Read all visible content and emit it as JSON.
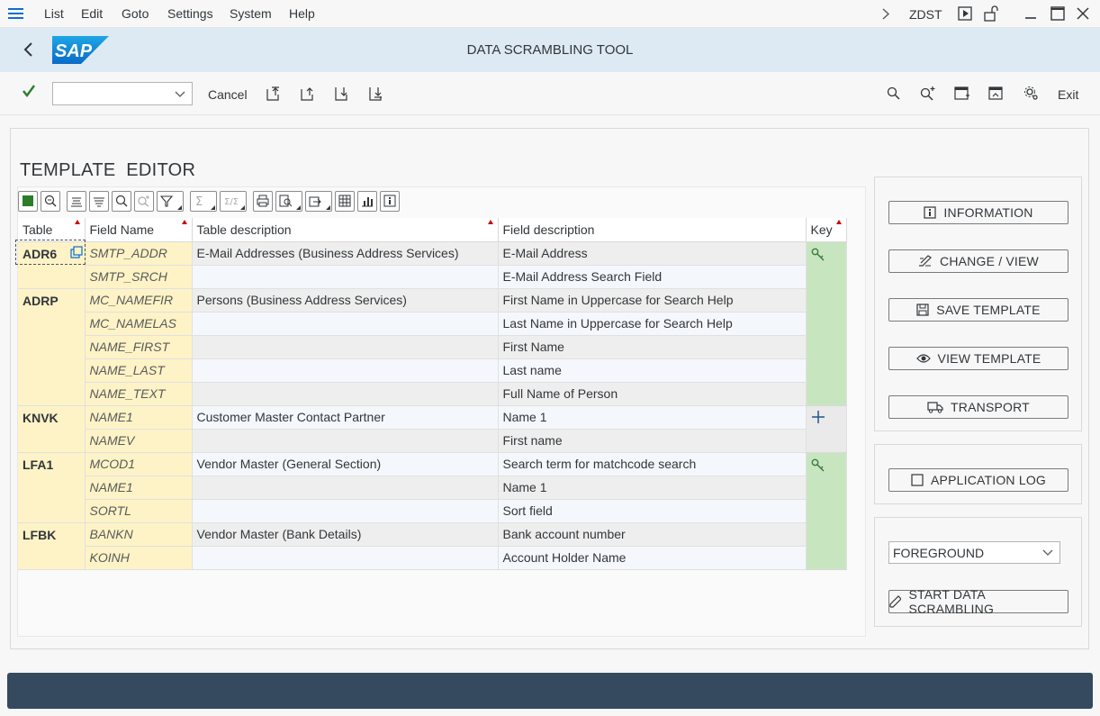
{
  "menu": {
    "items": [
      "List",
      "Edit",
      "Goto",
      "Settings",
      "System",
      "Help"
    ],
    "transaction_code": "ZDST"
  },
  "title_bar": {
    "logo_text": "SAP",
    "title": "DATA SCRAMBLING TOOL"
  },
  "toolbar": {
    "okcode_value": "",
    "cancel_label": "Cancel",
    "exit_label": "Exit"
  },
  "editor": {
    "title": "TEMPLATE  EDITOR",
    "columns": [
      "Table",
      "Field Name",
      "Table description",
      "Field description",
      "Key"
    ],
    "rows": [
      {
        "table": "ADR6",
        "field": "SMTP_ADDR",
        "table_desc": "E-Mail Addresses (Business Address Services)",
        "field_desc": "E-Mail Address",
        "key_icon": "key-icon"
      },
      {
        "table": "",
        "field": "SMTP_SRCH",
        "table_desc": "",
        "field_desc": "E-Mail Address Search Field",
        "key_icon": ""
      },
      {
        "table": "ADRP",
        "field": "MC_NAMEFIR",
        "table_desc": "Persons (Business Address Services)",
        "field_desc": "First Name in Uppercase for Search Help",
        "key_icon": ""
      },
      {
        "table": "",
        "field": "MC_NAMELAS",
        "table_desc": "",
        "field_desc": "Last Name in Uppercase for Search Help",
        "key_icon": ""
      },
      {
        "table": "",
        "field": "NAME_FIRST",
        "table_desc": "",
        "field_desc": "First Name",
        "key_icon": ""
      },
      {
        "table": "",
        "field": "NAME_LAST",
        "table_desc": "",
        "field_desc": "Last name",
        "key_icon": ""
      },
      {
        "table": "",
        "field": "NAME_TEXT",
        "table_desc": "",
        "field_desc": "Full Name of Person",
        "key_icon": ""
      },
      {
        "table": "KNVK",
        "field": "NAME1",
        "table_desc": "Customer Master Contact Partner",
        "field_desc": "Name 1",
        "key_icon": "plus-icon"
      },
      {
        "table": "",
        "field": "NAMEV",
        "table_desc": "",
        "field_desc": "First name",
        "key_icon": ""
      },
      {
        "table": "LFA1",
        "field": "MCOD1",
        "table_desc": "Vendor Master (General Section)",
        "field_desc": "Search term for matchcode search",
        "key_icon": "key-icon"
      },
      {
        "table": "",
        "field": "NAME1",
        "table_desc": "",
        "field_desc": "Name 1",
        "key_icon": ""
      },
      {
        "table": "",
        "field": "SORTL",
        "table_desc": "",
        "field_desc": "Sort field",
        "key_icon": ""
      },
      {
        "table": "LFBK",
        "field": "BANKN",
        "table_desc": "Vendor Master (Bank Details)",
        "field_desc": "Bank account number",
        "key_icon": ""
      },
      {
        "table": "",
        "field": "KOINH",
        "table_desc": "",
        "field_desc": "Account Holder Name",
        "key_icon": ""
      }
    ]
  },
  "actions": {
    "information": "INFORMATION",
    "change_view": "CHANGE / VIEW",
    "save_template": "SAVE TEMPLATE",
    "view_template": "VIEW TEMPLATE",
    "transport": "TRANSPORT",
    "application_log": "APPLICATION LOG",
    "mode_value": "FOREGROUND",
    "start_scrambling": "START DATA SCRAMBLING"
  },
  "colors": {
    "accent": "#0a6ed1",
    "title_bar_bg": "#dde9f3",
    "key_column_bg": "#c7e6c0",
    "table_field_bg": "#fdf3c6",
    "footer_bg": "#354a5f"
  }
}
